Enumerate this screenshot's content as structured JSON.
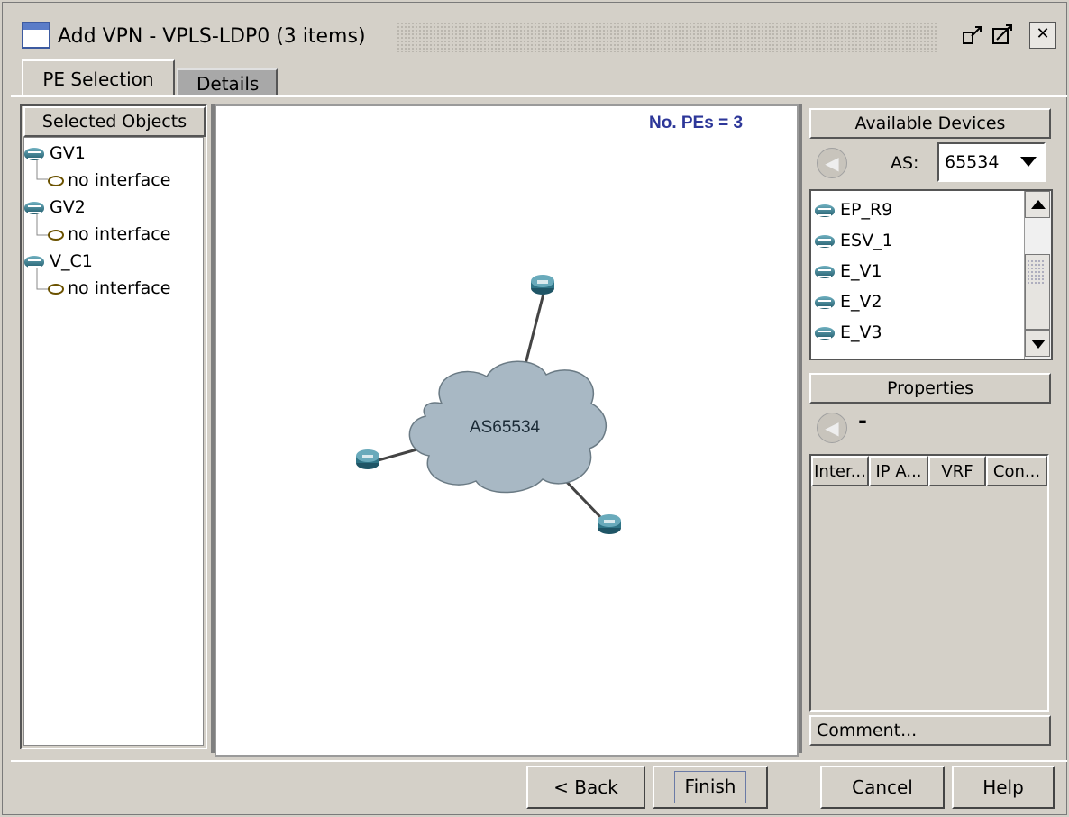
{
  "window": {
    "title": "Add VPN - VPLS-LDP0 (3 items)",
    "icons": [
      "window-icon",
      "minimize-icon",
      "maximize-icon",
      "close-icon"
    ]
  },
  "tabs": [
    {
      "label": "PE Selection",
      "active": true
    },
    {
      "label": "Details",
      "active": false
    }
  ],
  "left_panel": {
    "header": "Selected Objects",
    "items": [
      {
        "name": "GV1",
        "interface": "no interface"
      },
      {
        "name": "GV2",
        "interface": "no interface"
      },
      {
        "name": "V_C1",
        "interface": "no interface"
      }
    ]
  },
  "canvas": {
    "pe_count_label": "No. PEs = 3",
    "cloud_label": "AS65534"
  },
  "available_devices": {
    "header": "Available Devices",
    "as_label": "AS:",
    "as_value": "65534",
    "devices": [
      "EP_R9",
      "ESV_1",
      "E_V1",
      "E_V2",
      "E_V3"
    ]
  },
  "properties": {
    "header": "Properties",
    "title_value": "-",
    "columns": [
      "Inter...",
      "IP A...",
      "VRF",
      "Con..."
    ],
    "comment_button": "Comment..."
  },
  "buttons": {
    "back": "< Back",
    "finish": "Finish",
    "cancel": "Cancel",
    "help": "Help"
  },
  "colors": {
    "background": "#d4d0c8",
    "pe_count_text": "#2d3799",
    "cloud_fill": "#a8b8c4",
    "router": "#2f6f80"
  }
}
